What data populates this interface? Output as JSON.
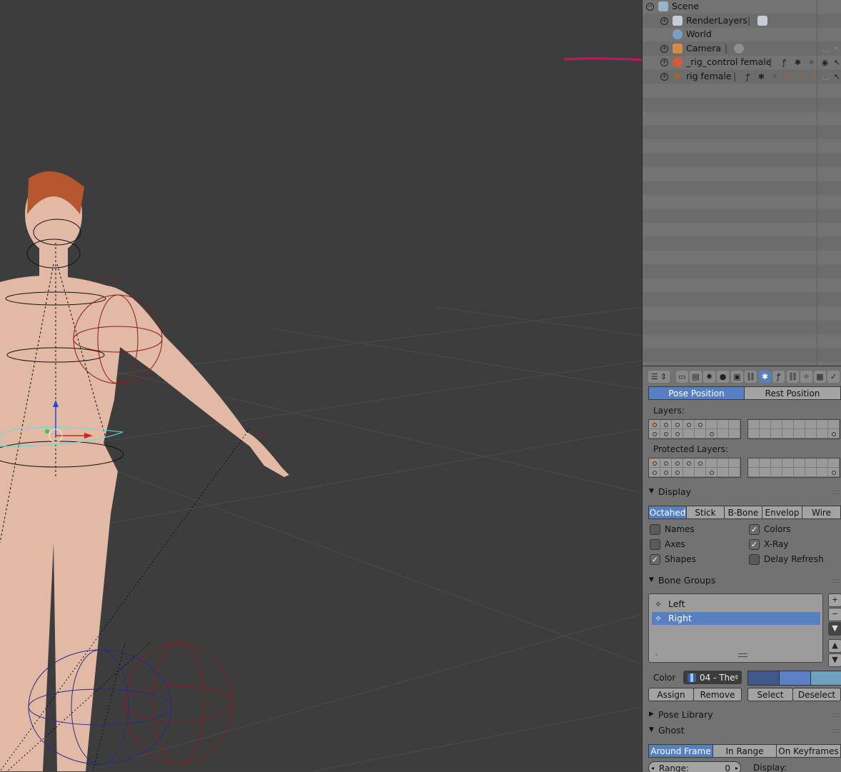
{
  "outliner": {
    "rows": [
      {
        "label": "Scene"
      },
      {
        "label": "RenderLayers"
      },
      {
        "label": "World"
      },
      {
        "label": "Camera"
      },
      {
        "label": "_rig_control female"
      },
      {
        "label": "rig female"
      }
    ]
  },
  "properties": {
    "pose_position_label": "Pose Position",
    "rest_position_label": "Rest Position",
    "layers_label": "Layers:",
    "protected_layers_label": "Protected Layers:",
    "display": {
      "header": "Display",
      "modes": [
        "Octahed",
        "Stick",
        "B-Bone",
        "Envelop",
        "Wire"
      ],
      "active_mode": "Octahed",
      "checkboxes": [
        {
          "label": "Names",
          "checked": false
        },
        {
          "label": "Colors",
          "checked": true
        },
        {
          "label": "Axes",
          "checked": false
        },
        {
          "label": "X-Ray",
          "checked": true
        },
        {
          "label": "Shapes",
          "checked": true
        },
        {
          "label": "Delay Refresh",
          "checked": false
        }
      ]
    },
    "bone_groups": {
      "header": "Bone Groups",
      "items": [
        {
          "label": "Left",
          "selected": false
        },
        {
          "label": "Right",
          "selected": true
        }
      ],
      "color_label": "Color",
      "color_value": "04 - The",
      "swatches": [
        "#3f5a8a",
        "#5b80c4",
        "#6da2bf"
      ],
      "assign_label": "Assign",
      "remove_label": "Remove",
      "select_label": "Select",
      "deselect_label": "Deselect"
    },
    "pose_library_header": "Pose Library",
    "ghost": {
      "header": "Ghost",
      "modes": [
        "Around Frame",
        "In Range",
        "On Keyframes"
      ],
      "active_mode": "Around Frame",
      "range_label": "Range:",
      "range_value": "0",
      "display_label": "Display:"
    }
  },
  "colors": {
    "accent": "#5680c2",
    "annotation_arrow": "#c2185b"
  }
}
